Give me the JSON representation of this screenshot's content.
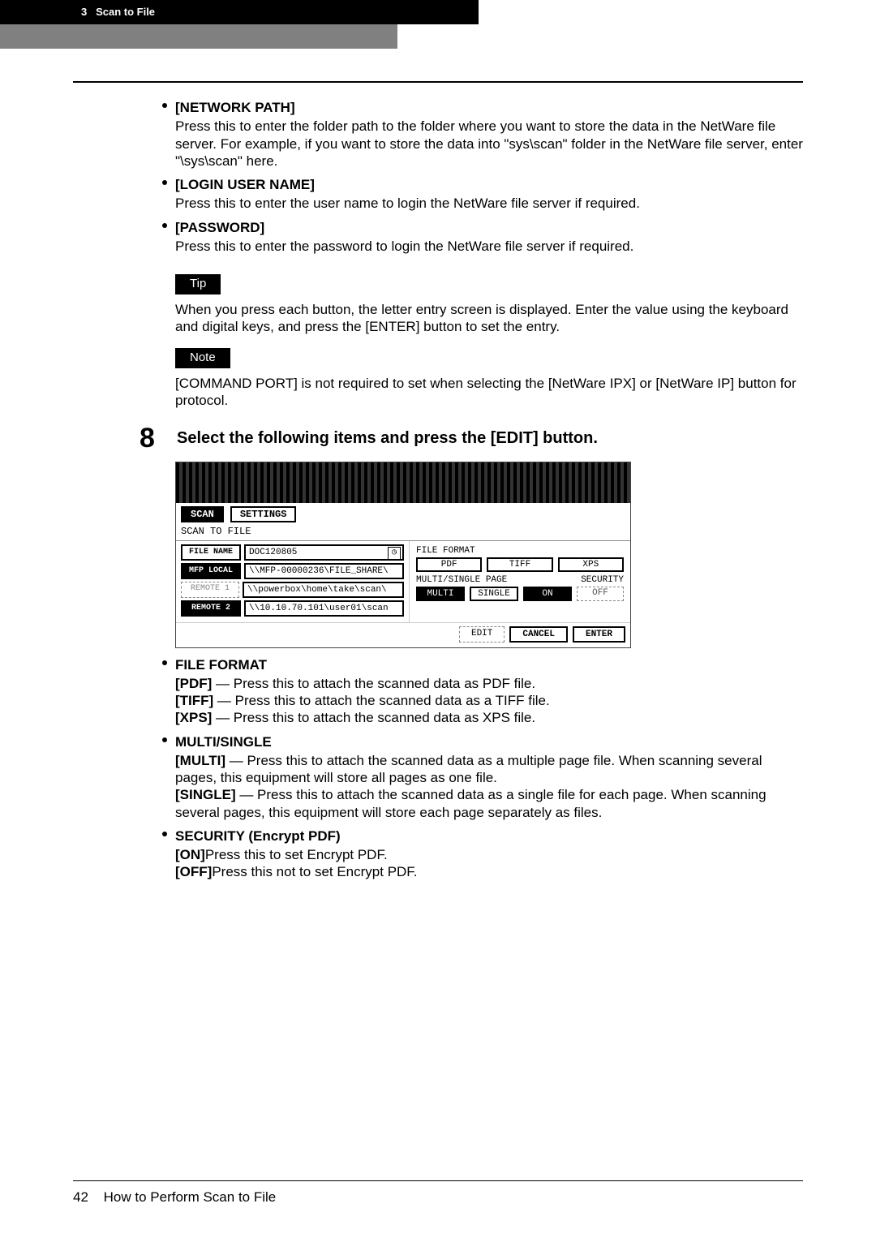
{
  "header": {
    "chapter": "3",
    "title": "Scan to File"
  },
  "items": {
    "network_path": {
      "title": "[NETWORK PATH]",
      "body": "Press this to enter the folder path to the folder where you want to store the data in the NetWare file server.  For example, if you want to store the data into \"sys\\scan\" folder in the NetWare file server, enter \"\\sys\\scan\" here."
    },
    "login_user_name": {
      "title": "[LOGIN USER NAME]",
      "body": "Press this to enter the user name to login the NetWare file server if required."
    },
    "password": {
      "title": "[PASSWORD]",
      "body": "Press this to enter the password to login the NetWare file server if required."
    }
  },
  "tip": {
    "label": "Tip",
    "body": "When you press each button, the letter entry screen is displayed. Enter the value using the keyboard and digital keys, and press the [ENTER] button to set the entry."
  },
  "note": {
    "label": "Note",
    "body": "[COMMAND PORT] is not required to set when selecting the [NetWare IPX] or [NetWare IP] button for protocol."
  },
  "step": {
    "number": "8",
    "title": "Select the following items and press the [EDIT] button."
  },
  "scan_screen": {
    "tabs": {
      "scan": "SCAN",
      "settings": "SETTINGS"
    },
    "subtitle": "SCAN TO FILE",
    "rows": [
      {
        "key": "FILE NAME",
        "value": "DOC120805",
        "active": false,
        "clock": true
      },
      {
        "key": "MFP LOCAL",
        "value": "\\\\MFP-00000236\\FILE_SHARE\\",
        "active": true
      },
      {
        "key": "REMOTE 1",
        "value": "\\\\powerbox\\home\\take\\scan\\",
        "active": false,
        "disabled": true
      },
      {
        "key": "REMOTE 2",
        "value": "\\\\10.10.70.101\\user01\\scan",
        "active": true
      }
    ],
    "right": {
      "file_format_label": "FILE FORMAT",
      "formats": [
        "PDF",
        "TIFF",
        "XPS"
      ],
      "multi_label": "MULTI/SINGLE PAGE",
      "security_label": "SECURITY",
      "multi_buttons": [
        "MULTI",
        "SINGLE"
      ],
      "sec_buttons": [
        "ON",
        "OFF"
      ]
    },
    "footer": {
      "edit": "EDIT",
      "cancel": "CANCEL",
      "enter": "ENTER"
    }
  },
  "below": {
    "file_format": {
      "title": "FILE FORMAT",
      "pdf_bold": "[PDF]",
      "pdf_rest": " — Press this to attach the scanned data as PDF file.",
      "tiff_bold": "[TIFF]",
      "tiff_rest": " — Press this to attach the scanned data as a TIFF file.",
      "xps_bold": "[XPS]",
      "xps_rest": " — Press this to attach the scanned data as XPS file."
    },
    "multi_single": {
      "title": "MULTI/SINGLE",
      "multi_bold": "[MULTI]",
      "multi_rest": " — Press this to attach the scanned data as a multiple page file.  When scanning several pages, this equipment will store all pages as one file.",
      "single_bold": "[SINGLE]",
      "single_rest": " — Press this to attach the scanned data as a single file for each page.  When scanning several pages, this equipment will store each page separately as files."
    },
    "security": {
      "title": "SECURITY (Encrypt PDF)",
      "on_bold": "[ON]",
      "on_rest": "Press this to set Encrypt PDF.",
      "off_bold": "[OFF]",
      "off_rest": "Press this not to set Encrypt PDF."
    }
  },
  "footer": {
    "page_number": "42",
    "text": "How to Perform Scan to File"
  }
}
